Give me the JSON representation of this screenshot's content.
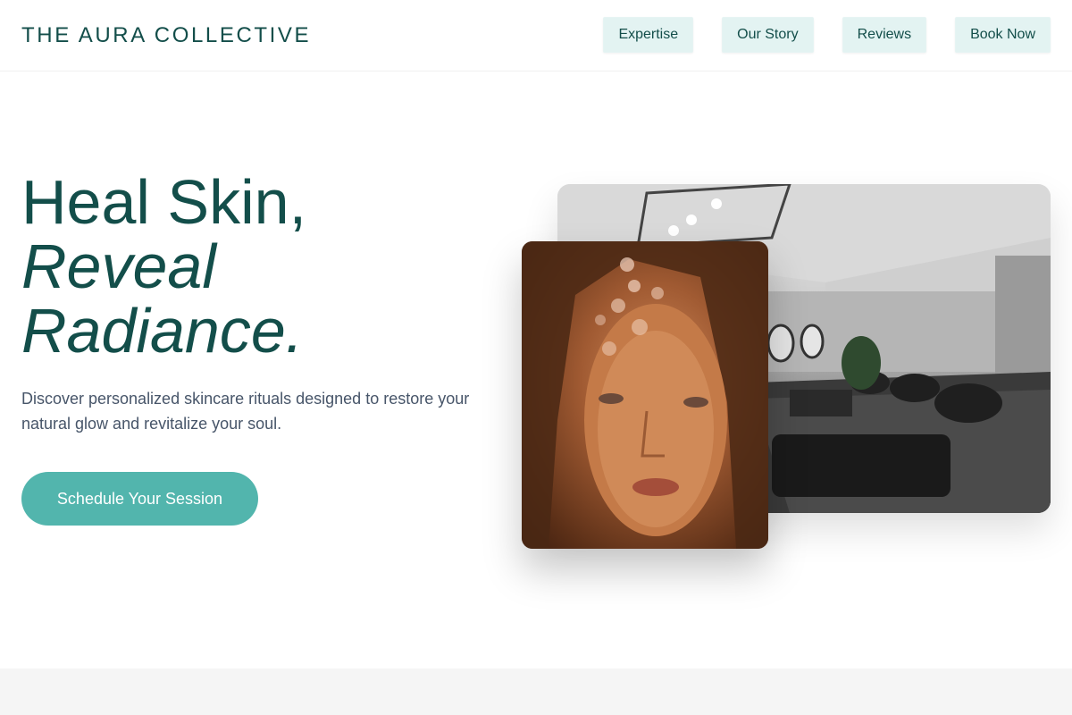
{
  "header": {
    "brand": "THE AURA COLLECTIVE",
    "nav": [
      {
        "label": "Expertise"
      },
      {
        "label": "Our Story"
      },
      {
        "label": "Reviews"
      },
      {
        "label": "Book Now"
      }
    ]
  },
  "hero": {
    "title_line1": "Heal Skin,",
    "title_line2": "Reveal",
    "title_line3": "Radiance.",
    "subtitle": "Discover personalized skincare rituals designed to restore your natural glow and revitalize your soul.",
    "cta_label": "Schedule Your Session"
  },
  "images": {
    "back": "salon-interior-photo",
    "front": "woman-portrait-photo"
  },
  "colors": {
    "brand": "#134e4a",
    "accent": "#52b5ad",
    "nav_bg": "#e3f3f2",
    "text_muted": "#475569"
  }
}
